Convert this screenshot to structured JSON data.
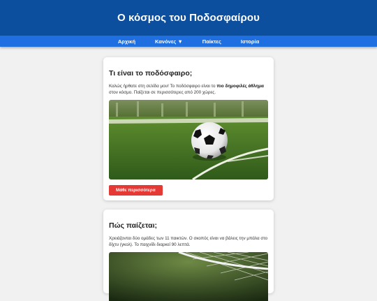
{
  "header": {
    "title": "Ο κόσμος του Ποδοσφαίρου"
  },
  "nav": {
    "items": [
      {
        "label": "Αρχική"
      },
      {
        "label": "Κανόνες ▼"
      },
      {
        "label": "Παίκτες"
      },
      {
        "label": "Ιστορία"
      }
    ]
  },
  "section1": {
    "title": "Τι είναι το ποδόσφαιρο;",
    "text_before": "Καλώς ήρθατε στη σελίδα μου! Το ποδόσφαιρο είναι το ",
    "text_bold": "πιο δημοφιλές άθλημα",
    "text_after": " στον κόσμο. Παίζεται σε περισσότερες από 200 χώρες.",
    "button_label": "Μάθε περισσότερα",
    "image_icon": "soccer-ball-on-pitch-image"
  },
  "section2": {
    "title": "Πώς παίζεται;",
    "text": "Χρειάζονται δύο ομάδες των 11 παικτών. Ο σκοπός είναι να βάλεις την μπάλα στο δίχτυ (γκολ). Το παιχνίδι διαρκεί 90 λεπτά.",
    "image_icon": "goal-net-image"
  },
  "colors": {
    "header_bg": "#0d4f9f",
    "nav_bg": "#1f6fe1",
    "button_bg": "#e53935",
    "page_bg": "#f1f1f1"
  }
}
